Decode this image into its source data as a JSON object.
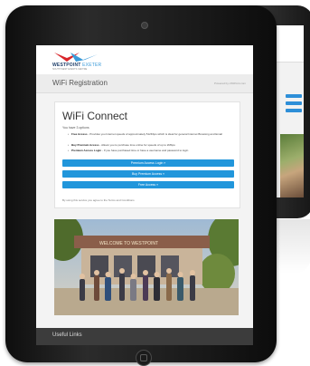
{
  "brand": {
    "name_primary": "WESTPOINT",
    "name_secondary": "EXETER",
    "tagline": "SOUTH WEST EVENTS CENTRE"
  },
  "header": {
    "title": "WiFi Registration",
    "powered_by": "Powered by cWiPoint.com"
  },
  "panel": {
    "heading": "WiFi Connect",
    "intro": "You have 3 options",
    "options": [
      {
        "label": "Free Access",
        "text": " - Provides you Internet speeds of approximately 512Kbps which is ideal for general Internet Browsing and Email"
      },
      {
        "label": "Buy Premium Access",
        "text": " - Allows you to purchase time online for speeds of up to 2Mbps"
      },
      {
        "label": "Premium Access Login",
        "text": " - If you have purchased time or have a username and password to login"
      }
    ],
    "buttons": {
      "premium_login": "Premium Access Login »",
      "buy_premium": "Buy Premium Access »",
      "free": "Free Access »"
    },
    "terms": "By using this service you agree to the Terms and Conditions"
  },
  "photo": {
    "sign_text": "WELCOME TO WESTPOINT",
    "slides": 4,
    "active_slide": 1
  },
  "footer": {
    "label": "Useful Links"
  },
  "colors": {
    "button_blue": "#2196db",
    "brand_red": "#d9262b",
    "brand_blue": "#3a9ad9",
    "footer_bg": "#3c3c3c"
  },
  "icons": [
    "camera-icon",
    "home-button-icon",
    "brand-logo-icon"
  ]
}
